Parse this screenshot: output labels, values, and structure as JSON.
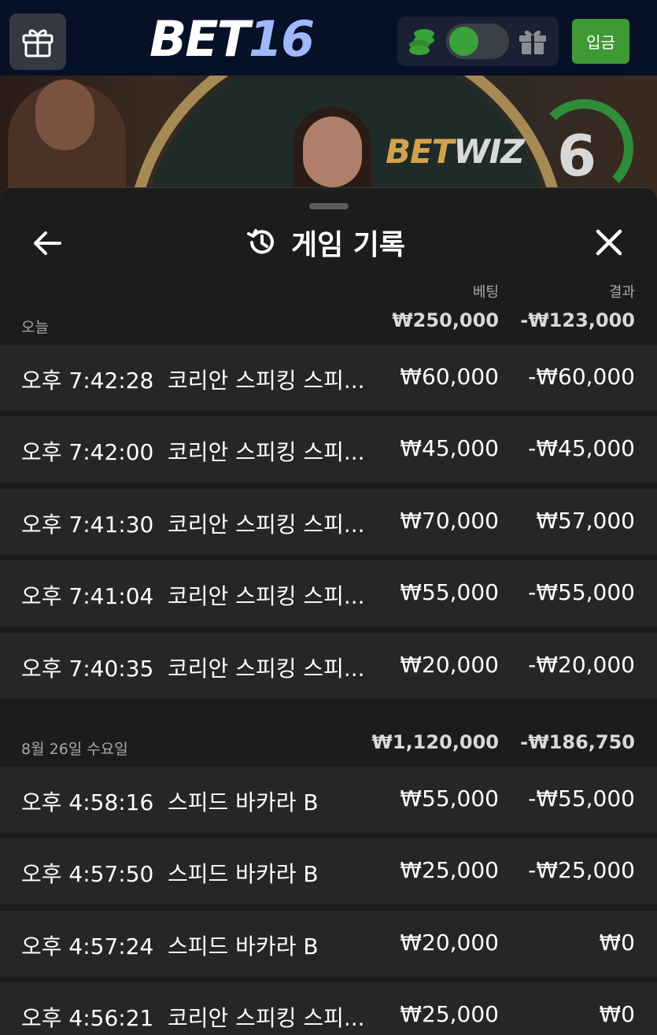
{
  "header": {
    "logo_main": "BET",
    "logo_num": "16",
    "deposit_label": "입금"
  },
  "video": {
    "brand_a": "BET",
    "brand_b": "WIZ",
    "countdown": "6"
  },
  "sheet": {
    "title": "게임 기록",
    "col_bet": "베팅",
    "col_result": "결과"
  },
  "sections": [
    {
      "date": "오늘",
      "total_bet": "₩250,000",
      "total_result": "-₩123,000",
      "rows": [
        {
          "time": "오후 7:42:28",
          "game": "코리안 스피킹 스피...",
          "bet": "₩60,000",
          "result": "-₩60,000"
        },
        {
          "time": "오후 7:42:00",
          "game": "코리안 스피킹 스피...",
          "bet": "₩45,000",
          "result": "-₩45,000"
        },
        {
          "time": "오후 7:41:30",
          "game": "코리안 스피킹 스피...",
          "bet": "₩70,000",
          "result": "₩57,000"
        },
        {
          "time": "오후 7:41:04",
          "game": "코리안 스피킹 스피...",
          "bet": "₩55,000",
          "result": "-₩55,000"
        },
        {
          "time": "오후 7:40:35",
          "game": "코리안 스피킹 스피...",
          "bet": "₩20,000",
          "result": "-₩20,000"
        }
      ]
    },
    {
      "date": "8월 26일 수요일",
      "total_bet": "₩1,120,000",
      "total_result": "-₩186,750",
      "rows": [
        {
          "time": "오후 4:58:16",
          "game": "스피드 바카라 B",
          "bet": "₩55,000",
          "result": "-₩55,000"
        },
        {
          "time": "오후 4:57:50",
          "game": "스피드 바카라 B",
          "bet": "₩25,000",
          "result": "-₩25,000"
        },
        {
          "time": "오후 4:57:24",
          "game": "스피드 바카라 B",
          "bet": "₩20,000",
          "result": "₩0"
        },
        {
          "time": "오후 4:56:21",
          "game": "코리안 스피킹 스피...",
          "bet": "₩25,000",
          "result": "₩0"
        }
      ]
    }
  ]
}
